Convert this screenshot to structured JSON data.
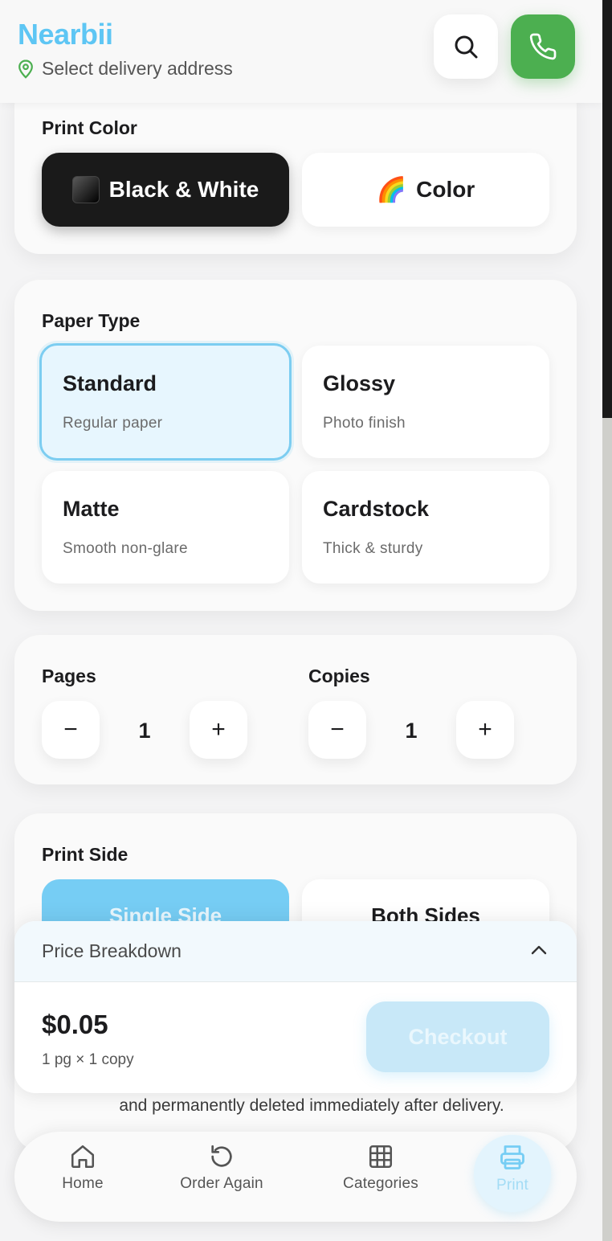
{
  "header": {
    "brand": "Nearbii",
    "address_prompt": "Select delivery address",
    "icons": {
      "location": "map-pin-icon",
      "search": "search-icon",
      "call": "phone-icon"
    },
    "colors": {
      "brand": "#5ec6f4",
      "call_button": "#4caf50",
      "location_pin": "#4caf50"
    }
  },
  "print_color": {
    "title": "Print Color",
    "options": [
      {
        "label": "Black & White",
        "icon": "⬛",
        "selected": true
      },
      {
        "label": "Color",
        "icon": "🌈",
        "selected": false
      }
    ]
  },
  "paper_type": {
    "title": "Paper Type",
    "options": [
      {
        "name": "Standard",
        "desc": "Regular paper",
        "selected": true
      },
      {
        "name": "Glossy",
        "desc": "Photo finish",
        "selected": false
      },
      {
        "name": "Matte",
        "desc": "Smooth non-glare",
        "selected": false
      },
      {
        "name": "Cardstock",
        "desc": "Thick & sturdy",
        "selected": false
      }
    ]
  },
  "quantity": {
    "pages": {
      "label": "Pages",
      "value": "1",
      "minus": "−",
      "plus": "+"
    },
    "copies": {
      "label": "Copies",
      "value": "1",
      "minus": "−",
      "plus": "+"
    }
  },
  "print_side": {
    "title": "Print Side",
    "options": [
      {
        "label": "Single Side",
        "selected": true
      },
      {
        "label": "Both Sides",
        "selected": false
      }
    ]
  },
  "notice": "and permanently deleted immediately after delivery.",
  "price": {
    "header_label": "Price Breakdown",
    "amount": "$0.05",
    "summary": "1 pg × 1 copy",
    "checkout_label": "Checkout",
    "chevron_icon": "chevron-up-icon"
  },
  "bottom_nav": {
    "items": [
      {
        "label": "Home",
        "icon": "home-icon",
        "active": false
      },
      {
        "label": "Order Again",
        "icon": "refresh-icon",
        "active": false
      },
      {
        "label": "Categories",
        "icon": "grid-icon",
        "active": false
      },
      {
        "label": "Print",
        "icon": "printer-icon",
        "active": true
      }
    ],
    "active_color": "#76cdf4"
  }
}
